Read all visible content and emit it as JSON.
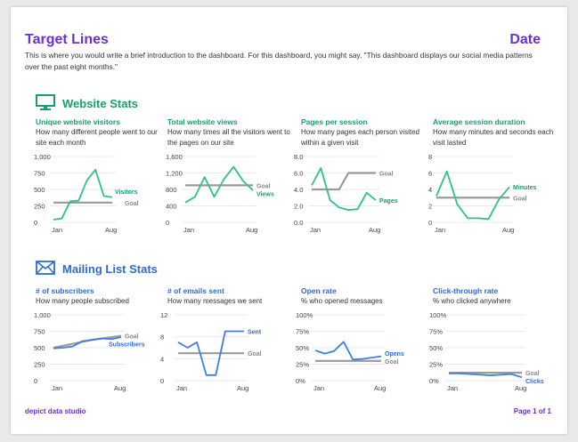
{
  "header": {
    "title": "Target Lines",
    "date": "Date",
    "intro": "This is where you would write a brief introduction to the dashboard. For this dashboard, you might say, \"This dashboard displays our social media patterns over the past eight months.\""
  },
  "sections": {
    "website": "Website Stats",
    "mailing": "Mailing List Stats"
  },
  "footer": {
    "left": "depict data studio",
    "right": "Page 1 of 1"
  },
  "colors": {
    "purple": "#6b2fd6",
    "green": "#2ec28a",
    "blue": "#3f7fe0",
    "gray": "#9a9a9a"
  },
  "chart_data": [
    {
      "id": "visitors",
      "type": "line",
      "group": "website",
      "title": "Unique website visitors",
      "subtitle": "How many different people went to our site each month",
      "ylim": [
        0,
        1000
      ],
      "yticks": [
        "0",
        "250",
        "500",
        "750",
        "1,000"
      ],
      "ytickvals": [
        0,
        250,
        500,
        750,
        1000
      ],
      "xlabels": [
        "Jan",
        "Aug"
      ],
      "series": [
        {
          "name": "Visitors",
          "values": [
            40,
            60,
            320,
            330,
            640,
            800,
            400,
            380
          ]
        },
        {
          "name": "Goal",
          "values": [
            300,
            300,
            300,
            300,
            300,
            300,
            300,
            300
          ]
        }
      ]
    },
    {
      "id": "views",
      "type": "line",
      "group": "website",
      "title": "Total website views",
      "subtitle": "How many times all the visitors went to the pages on our site",
      "ylim": [
        0,
        1600
      ],
      "yticks": [
        "0",
        "400",
        "800",
        "1,200",
        "1,600"
      ],
      "ytickvals": [
        0,
        400,
        800,
        1200,
        1600
      ],
      "xlabels": [
        "Jan",
        "Aug"
      ],
      "series": [
        {
          "name": "Views",
          "values": [
            480,
            620,
            1100,
            620,
            1050,
            1350,
            1000,
            780
          ]
        },
        {
          "name": "Goal",
          "values": [
            900,
            900,
            900,
            900,
            900,
            900,
            900,
            900
          ]
        }
      ]
    },
    {
      "id": "pages",
      "type": "line",
      "group": "website",
      "title": "Pages per session",
      "subtitle": "How many pages each person visited within a given visit",
      "ylim": [
        0,
        8
      ],
      "yticks": [
        "0.0",
        "2.0",
        "4.0",
        "6.0",
        "8.0"
      ],
      "ytickvals": [
        0,
        2,
        4,
        6,
        8
      ],
      "xlabels": [
        "Jan",
        "Aug"
      ],
      "series": [
        {
          "name": "Pages",
          "values": [
            4.5,
            6.6,
            2.7,
            1.8,
            1.5,
            1.6,
            3.6,
            2.7
          ]
        },
        {
          "name": "Goal",
          "values": [
            4.0,
            4.0,
            4.0,
            4.0,
            6.0,
            6.0,
            6.0,
            6.0
          ]
        }
      ]
    },
    {
      "id": "minutes",
      "type": "line",
      "group": "website",
      "title": "Average session duration",
      "subtitle": "How many minutes and seconds each visit lasted",
      "ylim": [
        0,
        8
      ],
      "yticks": [
        "0",
        "2",
        "4",
        "6",
        "8"
      ],
      "ytickvals": [
        0,
        2,
        4,
        6,
        8
      ],
      "xlabels": [
        "Jan",
        "Aug"
      ],
      "series": [
        {
          "name": "Minutes",
          "values": [
            3.2,
            6.2,
            2.2,
            0.5,
            0.5,
            0.4,
            2.8,
            4.3
          ]
        },
        {
          "name": "Goal",
          "values": [
            3.0,
            3.0,
            3.0,
            3.0,
            3.0,
            3.0,
            3.0,
            3.0
          ]
        }
      ]
    },
    {
      "id": "subscribers",
      "type": "line",
      "group": "mailing",
      "title": "# of subscribers",
      "subtitle": "How many people subscribed",
      "ylim": [
        0,
        1000
      ],
      "yticks": [
        "0",
        "250",
        "500",
        "750",
        "1,000"
      ],
      "ytickvals": [
        0,
        250,
        500,
        750,
        1000
      ],
      "xlabels": [
        "Jan",
        "Aug"
      ],
      "series": [
        {
          "name": "Subscribers",
          "values": [
            490,
            500,
            520,
            600,
            620,
            640,
            630,
            660
          ]
        },
        {
          "name": "Goal",
          "values": [
            500,
            530,
            560,
            590,
            620,
            640,
            660,
            680
          ]
        }
      ]
    },
    {
      "id": "emails",
      "type": "line",
      "group": "mailing",
      "title": "# of emails sent",
      "subtitle": "How many messages we sent",
      "ylim": [
        0,
        12
      ],
      "yticks": [
        "0",
        "4",
        "8",
        "12"
      ],
      "ytickvals": [
        0,
        4,
        8,
        12
      ],
      "xlabels": [
        "Jan",
        "Aug"
      ],
      "series": [
        {
          "name": "Sent",
          "values": [
            7,
            6,
            7,
            1,
            1,
            9,
            9,
            9
          ]
        },
        {
          "name": "Goal",
          "values": [
            5,
            5,
            5,
            5,
            5,
            5,
            5,
            5
          ]
        }
      ]
    },
    {
      "id": "openrate",
      "type": "line",
      "group": "mailing",
      "title": "Open rate",
      "subtitle": "% who opened messages",
      "ylim": [
        0,
        100
      ],
      "yticks": [
        "0%",
        "25%",
        "50%",
        "75%",
        "100%"
      ],
      "ytickvals": [
        0,
        25,
        50,
        75,
        100
      ],
      "xlabels": [
        "Jan",
        "Aug"
      ],
      "series": [
        {
          "name": "Opens",
          "values": [
            46,
            41,
            45,
            59,
            32,
            33,
            35,
            37
          ]
        },
        {
          "name": "Goal",
          "values": [
            30,
            30,
            30,
            30,
            30,
            30,
            30,
            30
          ]
        }
      ]
    },
    {
      "id": "ctr",
      "type": "line",
      "group": "mailing",
      "title": "Click-through rate",
      "subtitle": "% who clicked anywhere",
      "ylim": [
        0,
        100
      ],
      "yticks": [
        "0%",
        "25%",
        "50%",
        "75%",
        "100%"
      ],
      "ytickvals": [
        0,
        25,
        50,
        75,
        100
      ],
      "xlabels": [
        "Jan",
        "Aug"
      ],
      "series": [
        {
          "name": "Clicks",
          "values": [
            11,
            11,
            10,
            9,
            8,
            9,
            10,
            5
          ]
        },
        {
          "name": "Goal",
          "values": [
            12,
            12,
            12,
            12,
            12,
            12,
            12,
            12
          ]
        }
      ]
    }
  ]
}
